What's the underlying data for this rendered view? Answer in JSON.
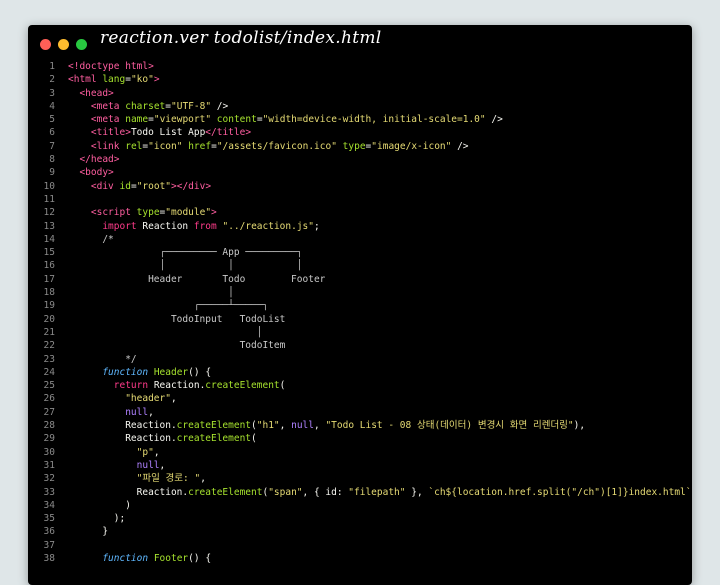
{
  "window": {
    "title": "reaction.ver   todolist/index.html",
    "colors": {
      "close": "#ff5f57",
      "minimize": "#febc2e",
      "zoom": "#28c840",
      "background": "#000000"
    }
  },
  "editor": {
    "lines": [
      {
        "n": "1",
        "tokens": [
          [
            "tag",
            "<!doctype html>"
          ]
        ]
      },
      {
        "n": "2",
        "tokens": [
          [
            "tag",
            "<html "
          ],
          [
            "attr",
            "lang"
          ],
          [
            "plain",
            "="
          ],
          [
            "str",
            "\"ko\""
          ],
          [
            "tag",
            ">"
          ]
        ]
      },
      {
        "n": "3",
        "tokens": [
          [
            "plain",
            "  "
          ],
          [
            "tag",
            "<head>"
          ]
        ]
      },
      {
        "n": "4",
        "tokens": [
          [
            "plain",
            "    "
          ],
          [
            "tag",
            "<meta "
          ],
          [
            "attr",
            "charset"
          ],
          [
            "plain",
            "="
          ],
          [
            "str",
            "\"UTF-8\""
          ],
          [
            "plain",
            " />"
          ]
        ]
      },
      {
        "n": "5",
        "tokens": [
          [
            "plain",
            "    "
          ],
          [
            "tag",
            "<meta "
          ],
          [
            "attr",
            "name"
          ],
          [
            "plain",
            "="
          ],
          [
            "str",
            "\"viewport\""
          ],
          [
            "plain",
            " "
          ],
          [
            "attr",
            "content"
          ],
          [
            "plain",
            "="
          ],
          [
            "str",
            "\"width=device-width, initial-scale=1.0\""
          ],
          [
            "plain",
            " />"
          ]
        ]
      },
      {
        "n": "6",
        "tokens": [
          [
            "plain",
            "    "
          ],
          [
            "tag",
            "<title>"
          ],
          [
            "plain",
            "Todo List App"
          ],
          [
            "tag",
            "</title>"
          ]
        ]
      },
      {
        "n": "7",
        "tokens": [
          [
            "plain",
            "    "
          ],
          [
            "tag",
            "<link "
          ],
          [
            "attr",
            "rel"
          ],
          [
            "plain",
            "="
          ],
          [
            "str",
            "\"icon\""
          ],
          [
            "plain",
            " "
          ],
          [
            "attr",
            "href"
          ],
          [
            "plain",
            "="
          ],
          [
            "str",
            "\"/assets/favicon.ico\""
          ],
          [
            "plain",
            " "
          ],
          [
            "attr",
            "type"
          ],
          [
            "plain",
            "="
          ],
          [
            "str",
            "\"image/x-icon\""
          ],
          [
            "plain",
            " />"
          ]
        ]
      },
      {
        "n": "8",
        "tokens": [
          [
            "plain",
            "  "
          ],
          [
            "tag",
            "</head>"
          ]
        ]
      },
      {
        "n": "9",
        "tokens": [
          [
            "plain",
            "  "
          ],
          [
            "tag",
            "<body>"
          ]
        ]
      },
      {
        "n": "10",
        "tokens": [
          [
            "plain",
            "    "
          ],
          [
            "tag",
            "<div "
          ],
          [
            "attr",
            "id"
          ],
          [
            "plain",
            "="
          ],
          [
            "str",
            "\"root\""
          ],
          [
            "tag",
            "></div>"
          ]
        ]
      },
      {
        "n": "11",
        "tokens": []
      },
      {
        "n": "12",
        "tokens": [
          [
            "plain",
            "    "
          ],
          [
            "tag",
            "<script "
          ],
          [
            "attr",
            "type"
          ],
          [
            "plain",
            "="
          ],
          [
            "str",
            "\"module\""
          ],
          [
            "tag",
            ">"
          ]
        ]
      },
      {
        "n": "13",
        "tokens": [
          [
            "plain",
            "      "
          ],
          [
            "kw",
            "import"
          ],
          [
            "plain",
            " Reaction "
          ],
          [
            "kw",
            "from"
          ],
          [
            "plain",
            " "
          ],
          [
            "str",
            "\"../reaction.js\""
          ],
          [
            "plain",
            ";"
          ]
        ]
      },
      {
        "n": "14",
        "tokens": [
          [
            "plain",
            "      "
          ],
          [
            "comment",
            "/*"
          ]
        ]
      },
      {
        "n": "15",
        "tokens": [
          [
            "comment",
            "                ┌───────── App ─────────┐"
          ]
        ]
      },
      {
        "n": "16",
        "tokens": [
          [
            "comment",
            "                │           │           │"
          ]
        ]
      },
      {
        "n": "17",
        "tokens": [
          [
            "comment",
            "              Header       Todo        Footer"
          ]
        ]
      },
      {
        "n": "18",
        "tokens": [
          [
            "comment",
            "                            │"
          ]
        ]
      },
      {
        "n": "19",
        "tokens": [
          [
            "comment",
            "                      ┌─────┴─────┐"
          ]
        ]
      },
      {
        "n": "20",
        "tokens": [
          [
            "comment",
            "                  TodoInput   TodoList"
          ]
        ]
      },
      {
        "n": "21",
        "tokens": [
          [
            "comment",
            "                                 │"
          ]
        ]
      },
      {
        "n": "22",
        "tokens": [
          [
            "comment",
            "                              TodoItem"
          ]
        ]
      },
      {
        "n": "23",
        "tokens": [
          [
            "comment",
            "          */"
          ]
        ]
      },
      {
        "n": "24",
        "tokens": [
          [
            "plain",
            "      "
          ],
          [
            "italic",
            "function"
          ],
          [
            "plain",
            " "
          ],
          [
            "func",
            "Header"
          ],
          [
            "plain",
            "() {"
          ]
        ]
      },
      {
        "n": "25",
        "tokens": [
          [
            "plain",
            "        "
          ],
          [
            "kw",
            "return"
          ],
          [
            "plain",
            " Reaction."
          ],
          [
            "func",
            "createElement"
          ],
          [
            "plain",
            "("
          ]
        ]
      },
      {
        "n": "26",
        "tokens": [
          [
            "plain",
            "          "
          ],
          [
            "str",
            "\"header\""
          ],
          [
            "plain",
            ","
          ]
        ]
      },
      {
        "n": "27",
        "tokens": [
          [
            "plain",
            "          "
          ],
          [
            "purple",
            "null"
          ],
          [
            "plain",
            ","
          ]
        ]
      },
      {
        "n": "28",
        "tokens": [
          [
            "plain",
            "          Reaction."
          ],
          [
            "func",
            "createElement"
          ],
          [
            "plain",
            "("
          ],
          [
            "str",
            "\"h1\""
          ],
          [
            "plain",
            ", "
          ],
          [
            "purple",
            "null"
          ],
          [
            "plain",
            ", "
          ],
          [
            "str",
            "\"Todo List - 08 상태(데이터) 변경시 화면 리렌더링\""
          ],
          [
            "plain",
            "),"
          ]
        ]
      },
      {
        "n": "29",
        "tokens": [
          [
            "plain",
            "          Reaction."
          ],
          [
            "func",
            "createElement"
          ],
          [
            "plain",
            "("
          ]
        ]
      },
      {
        "n": "30",
        "tokens": [
          [
            "plain",
            "            "
          ],
          [
            "str",
            "\"p\""
          ],
          [
            "plain",
            ","
          ]
        ]
      },
      {
        "n": "31",
        "tokens": [
          [
            "plain",
            "            "
          ],
          [
            "purple",
            "null"
          ],
          [
            "plain",
            ","
          ]
        ]
      },
      {
        "n": "32",
        "tokens": [
          [
            "plain",
            "            "
          ],
          [
            "str",
            "\"파일 경로: \""
          ],
          [
            "plain",
            ","
          ]
        ]
      },
      {
        "n": "33",
        "tokens": [
          [
            "plain",
            "            Reaction."
          ],
          [
            "func",
            "createElement"
          ],
          [
            "plain",
            "("
          ],
          [
            "str",
            "\"span\""
          ],
          [
            "plain",
            ", { id: "
          ],
          [
            "str",
            "\"filepath\""
          ],
          [
            "plain",
            " }, "
          ],
          [
            "str",
            "`ch${location.href.split(\"/ch\")[1]}index.html`"
          ],
          [
            "plain",
            ")"
          ]
        ]
      },
      {
        "n": "34",
        "tokens": [
          [
            "plain",
            "          )"
          ]
        ]
      },
      {
        "n": "35",
        "tokens": [
          [
            "plain",
            "        );"
          ]
        ]
      },
      {
        "n": "36",
        "tokens": [
          [
            "plain",
            "      }"
          ]
        ]
      },
      {
        "n": "37",
        "tokens": []
      },
      {
        "n": "38",
        "tokens": [
          [
            "plain",
            "      "
          ],
          [
            "italic",
            "function"
          ],
          [
            "plain",
            " "
          ],
          [
            "func",
            "Footer"
          ],
          [
            "plain",
            "() {"
          ]
        ]
      }
    ]
  }
}
